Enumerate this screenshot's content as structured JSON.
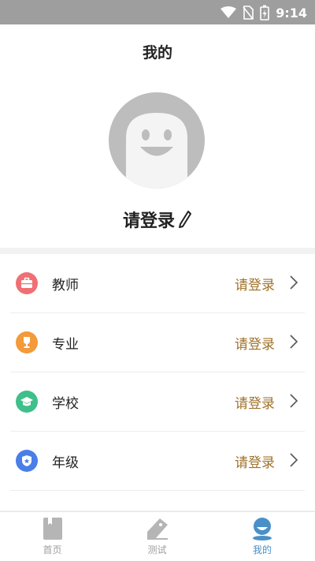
{
  "status_bar": {
    "time": "9:14"
  },
  "header": {
    "title": "我的",
    "login_text": "请登录"
  },
  "rows": [
    {
      "label": "教师",
      "value": "请登录",
      "icon": "briefcase-icon",
      "color": "#ef6f73"
    },
    {
      "label": "专业",
      "value": "请登录",
      "icon": "trophy-icon",
      "color": "#f39a3a"
    },
    {
      "label": "学校",
      "value": "请登录",
      "icon": "graduation-cap-icon",
      "color": "#3fbf8a"
    },
    {
      "label": "年级",
      "value": "请登录",
      "icon": "badge-star-icon",
      "color": "#4a7ee8"
    }
  ],
  "tabs": [
    {
      "label": "首页",
      "icon": "book-icon",
      "active": false
    },
    {
      "label": "测试",
      "icon": "pencil-icon",
      "active": false
    },
    {
      "label": "我的",
      "icon": "profile-face-icon",
      "active": true
    }
  ],
  "colors": {
    "accent": "#4a90c8",
    "value_text": "#a0722a"
  }
}
